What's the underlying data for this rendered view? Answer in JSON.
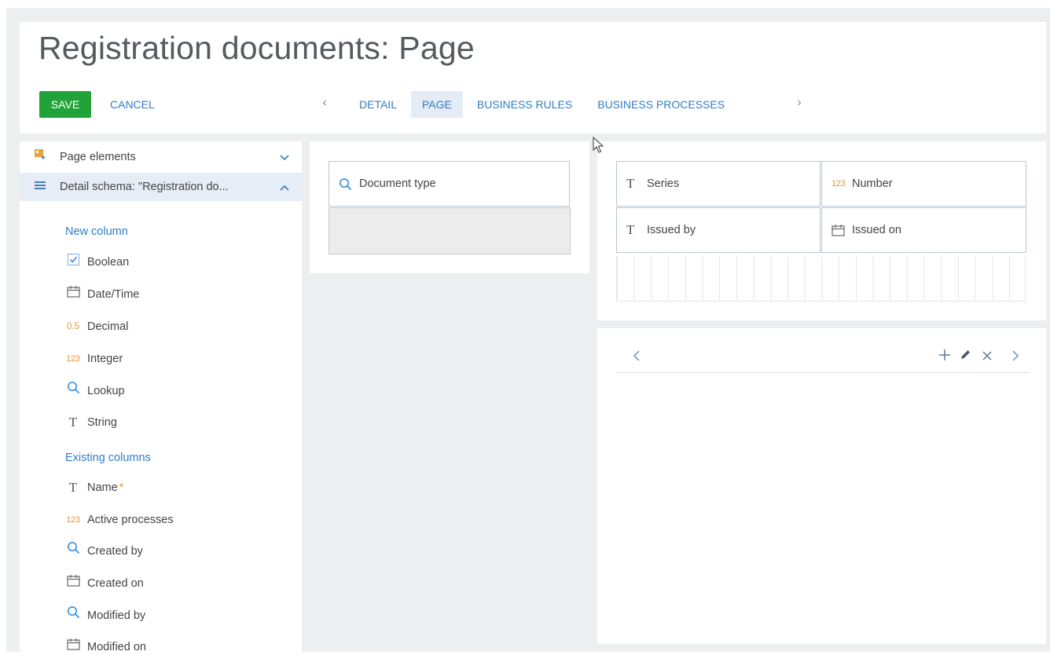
{
  "header": {
    "title": "Registration documents: Page",
    "save_label": "SAVE",
    "cancel_label": "CANCEL",
    "tabs": [
      {
        "label": "DETAIL",
        "active": false
      },
      {
        "label": "PAGE",
        "active": true
      },
      {
        "label": "BUSINESS RULES",
        "active": false
      },
      {
        "label": "BUSINESS PROCESSES",
        "active": false
      }
    ]
  },
  "sidebar": {
    "page_elements_label": "Page elements",
    "detail_schema_label": "Detail schema: \"Registration do...",
    "new_column_label": "New column",
    "new_columns": [
      {
        "label": "Boolean",
        "icon": "checkbox-icon"
      },
      {
        "label": "Date/Time",
        "icon": "calendar-icon"
      },
      {
        "label": "Decimal",
        "icon": "decimal-icon",
        "icon_text": "0.5"
      },
      {
        "label": "Integer",
        "icon": "integer-icon",
        "icon_text": "123"
      },
      {
        "label": "Lookup",
        "icon": "search-icon"
      },
      {
        "label": "String",
        "icon": "text-icon",
        "icon_text": "T"
      }
    ],
    "existing_columns_label": "Existing columns",
    "existing_columns": [
      {
        "label": "Name",
        "icon": "text-icon",
        "icon_text": "T",
        "required_mark": "*"
      },
      {
        "label": "Active processes",
        "icon": "integer-icon",
        "icon_text": "123"
      },
      {
        "label": "Created by",
        "icon": "search-icon"
      },
      {
        "label": "Created on",
        "icon": "calendar-icon"
      },
      {
        "label": "Modified by",
        "icon": "search-icon"
      },
      {
        "label": "Modified on",
        "icon": "calendar-icon"
      }
    ]
  },
  "canvas": {
    "document_type_label": "Document type",
    "fields": [
      {
        "label": "Series",
        "icon": "text-icon",
        "icon_text": "T"
      },
      {
        "label": "Number",
        "icon": "integer-icon",
        "icon_text": "123"
      },
      {
        "label": "Issued by",
        "icon": "text-icon",
        "icon_text": "T"
      },
      {
        "label": "Issued on",
        "icon": "calendar-icon"
      }
    ]
  },
  "colors": {
    "accent": "#2f7ec7",
    "save": "#22a33a",
    "orange": "#e8963a",
    "active_tab_bg": "#e4ecf6"
  }
}
